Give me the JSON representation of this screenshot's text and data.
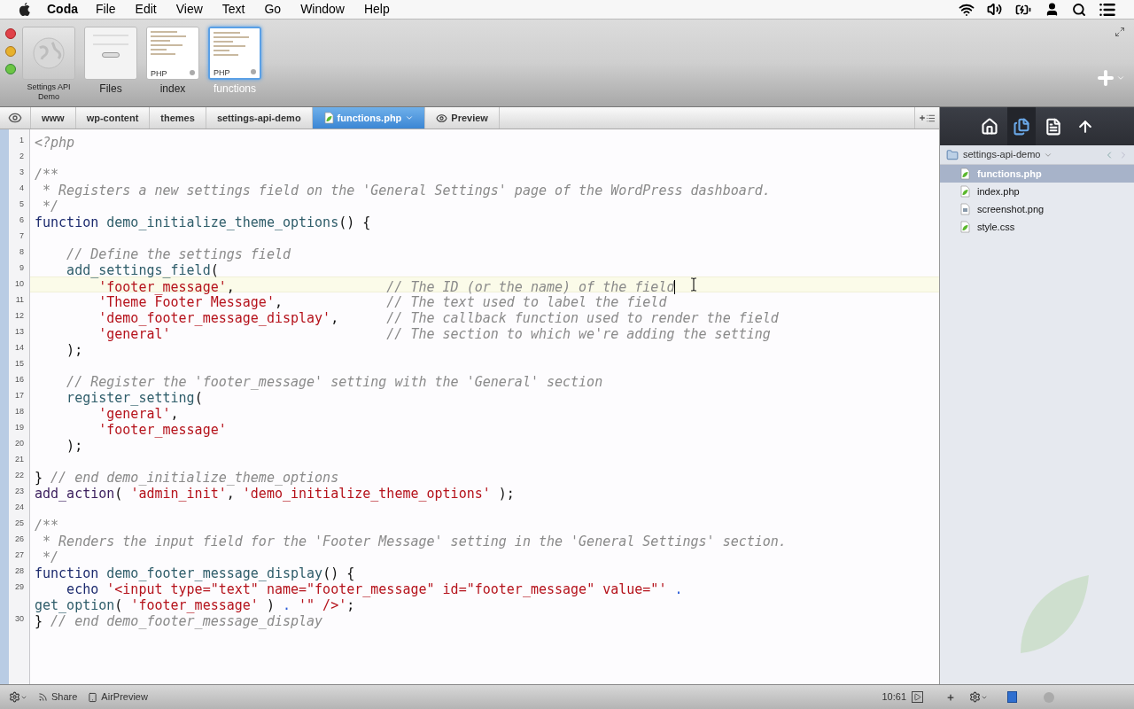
{
  "menubar": {
    "app": "Coda",
    "menus": [
      "File",
      "Edit",
      "View",
      "Text",
      "Go",
      "Window",
      "Help"
    ]
  },
  "sites": [
    {
      "label": "Settings API Demo",
      "kind": "site",
      "selected": false
    },
    {
      "label": "Files",
      "kind": "files",
      "selected": false
    },
    {
      "label": "index",
      "kind": "php",
      "badge": "PHP",
      "selected": false
    },
    {
      "label": "functions",
      "kind": "php",
      "badge": "PHP",
      "selected": true
    }
  ],
  "path": [
    {
      "label": "www",
      "kind": "folder",
      "selected": false
    },
    {
      "label": "wp-content",
      "kind": "folder",
      "selected": false
    },
    {
      "label": "themes",
      "kind": "folder",
      "selected": false
    },
    {
      "label": "settings-api-demo",
      "kind": "folder",
      "selected": false
    },
    {
      "label": "functions.php",
      "kind": "file",
      "selected": true
    },
    {
      "label": "Preview",
      "kind": "preview",
      "selected": false
    }
  ],
  "editor": {
    "lines": [
      {
        "number": "1",
        "tokens": [
          {
            "kind": "cm",
            "text": "<?php"
          }
        ]
      },
      {
        "number": "2"
      },
      {
        "number": "3",
        "tokens": [
          {
            "kind": "cm",
            "text": "/**"
          }
        ]
      },
      {
        "number": "4",
        "tokens": [
          {
            "kind": "cm",
            "text": " * Registers a new settings field on the 'General Settings' page of the WordPress dashboard."
          }
        ]
      },
      {
        "number": "5",
        "tokens": [
          {
            "kind": "cm",
            "text": " */"
          }
        ]
      },
      {
        "number": "6",
        "tokens": [
          {
            "kind": "kw",
            "text": "function"
          },
          {
            "kind": "fn",
            "text": " demo_initialize_theme_options"
          },
          {
            "kind": "p",
            "text": "() {"
          }
        ]
      },
      {
        "number": "7"
      },
      {
        "number": "8",
        "tokens": [
          {
            "kind": "cm",
            "text": "    // Define the settings field"
          }
        ]
      },
      {
        "number": "9",
        "tokens": [
          {
            "kind": "fn",
            "text": "    add_settings_field"
          },
          {
            "kind": "p",
            "text": "("
          }
        ]
      },
      {
        "number": "10",
        "current": true,
        "tokens": [
          {
            "kind": "str",
            "text": "        'footer_message'"
          },
          {
            "kind": "p",
            "text": ","
          }
        ],
        "comment": "// The ID (or the name) of the field"
      },
      {
        "number": "11",
        "tokens": [
          {
            "kind": "str",
            "text": "        'Theme Footer Message'"
          },
          {
            "kind": "p",
            "text": ","
          }
        ],
        "comment": "// The text used to label the field"
      },
      {
        "number": "12",
        "tokens": [
          {
            "kind": "str",
            "text": "        'demo_footer_message_display'"
          },
          {
            "kind": "p",
            "text": ","
          }
        ],
        "comment": "// The callback function used to render the field"
      },
      {
        "number": "13",
        "tokens": [
          {
            "kind": "str",
            "text": "        'general'"
          }
        ],
        "comment": "// The section to which we're adding the setting"
      },
      {
        "number": "14",
        "tokens": [
          {
            "kind": "p",
            "text": "    );"
          }
        ]
      },
      {
        "number": "15"
      },
      {
        "number": "16",
        "tokens": [
          {
            "kind": "cm",
            "text": "    // Register the 'footer_message' setting with the 'General' section"
          }
        ]
      },
      {
        "number": "17",
        "tokens": [
          {
            "kind": "fn",
            "text": "    register_setting"
          },
          {
            "kind": "p",
            "text": "("
          }
        ]
      },
      {
        "number": "18",
        "tokens": [
          {
            "kind": "str",
            "text": "        'general'"
          },
          {
            "kind": "p",
            "text": ","
          }
        ]
      },
      {
        "number": "19",
        "tokens": [
          {
            "kind": "str",
            "text": "        'footer_message'"
          }
        ]
      },
      {
        "number": "20",
        "tokens": [
          {
            "kind": "p",
            "text": "    );"
          }
        ]
      },
      {
        "number": "21"
      },
      {
        "number": "22",
        "tokens": [
          {
            "kind": "p",
            "text": "}"
          },
          {
            "kind": "cm",
            "text": " // end demo_initialize_theme_options"
          }
        ]
      },
      {
        "number": "23",
        "tokens": [
          {
            "kind": "call",
            "text": "add_action"
          },
          {
            "kind": "p",
            "text": "( "
          },
          {
            "kind": "str",
            "text": "'admin_init'"
          },
          {
            "kind": "p",
            "text": ", "
          },
          {
            "kind": "str",
            "text": "'demo_initialize_theme_options'"
          },
          {
            "kind": "p",
            "text": " );"
          }
        ]
      },
      {
        "number": "24"
      },
      {
        "number": "25",
        "tokens": [
          {
            "kind": "cm",
            "text": "/**"
          }
        ]
      },
      {
        "number": "26",
        "tokens": [
          {
            "kind": "cm",
            "text": " * Renders the input field for the 'Footer Message' setting in the 'General Settings' section."
          }
        ]
      },
      {
        "number": "27",
        "tokens": [
          {
            "kind": "cm",
            "text": " */"
          }
        ]
      },
      {
        "number": "28",
        "tokens": [
          {
            "kind": "kw",
            "text": "function"
          },
          {
            "kind": "fn",
            "text": " demo_footer_message_display"
          },
          {
            "kind": "p",
            "text": "() {"
          }
        ]
      },
      {
        "number": "29",
        "tokens": [
          {
            "kind": "kw",
            "text": "    echo"
          },
          {
            "kind": "str",
            "text": " '<input type=\"text\" name=\"footer_message\" id=\"footer_message\" value=\"'"
          },
          {
            "kind": "op",
            "text": " ."
          }
        ]
      },
      {
        "tokens": [
          {
            "kind": "fn",
            "text": "get_option"
          },
          {
            "kind": "p",
            "text": "( "
          },
          {
            "kind": "str",
            "text": "'footer_message'"
          },
          {
            "kind": "p",
            "text": " ) "
          },
          {
            "kind": "op",
            "text": "."
          },
          {
            "kind": "str",
            "text": " '\" />'"
          },
          {
            "kind": "p",
            "text": ";"
          }
        ]
      },
      {
        "number": "30",
        "tokens": [
          {
            "kind": "p",
            "text": "}"
          },
          {
            "kind": "cm",
            "text": " // end demo_footer_message_display"
          }
        ]
      }
    ]
  },
  "sidebar": {
    "tabs": [
      {
        "kind": "home",
        "selected": false
      },
      {
        "kind": "files",
        "selected": true
      },
      {
        "kind": "doc",
        "selected": false
      },
      {
        "kind": "publish",
        "selected": false
      }
    ],
    "folder": "settings-api-demo",
    "files": [
      {
        "name": "functions.php",
        "kind": "php",
        "selected": true
      },
      {
        "name": "index.php",
        "kind": "php",
        "selected": false
      },
      {
        "name": "screenshot.png",
        "kind": "image",
        "selected": false
      },
      {
        "name": "style.css",
        "kind": "css",
        "selected": false
      }
    ]
  },
  "status_bar": {
    "share": "Share",
    "airpreview": "AirPreview",
    "position": "10:61"
  }
}
